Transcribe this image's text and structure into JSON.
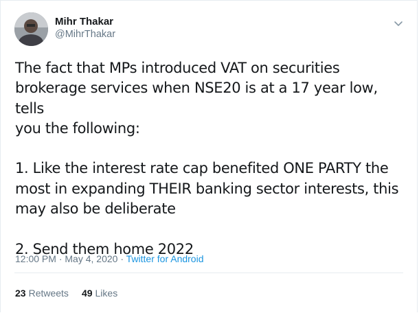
{
  "tweet": {
    "author": {
      "display_name": "Mihr Thakar",
      "handle": "@MihrThakar"
    },
    "text": "The fact that MPs introduced VAT on securities\nbrokerage services when NSE20 is at a 17 year low, tells\nyou the following:\n\n1. Like the interest rate cap benefited ONE PARTY the\nmost in expanding THEIR banking sector interests, this\nmay also be deliberate\n\n2. Send them home 2022",
    "time": "12:00 PM",
    "separator": "·",
    "date": "May 4, 2020",
    "source": "Twitter for Android",
    "retweets": {
      "count": "23",
      "label": "Retweets"
    },
    "likes": {
      "count": "49",
      "label": "Likes"
    }
  },
  "colors": {
    "text": "#14171a",
    "secondary": "#657786",
    "link": "#1b95e0",
    "border": "#e6ecf0"
  },
  "icons": {
    "menu": "chevron-down-icon"
  }
}
